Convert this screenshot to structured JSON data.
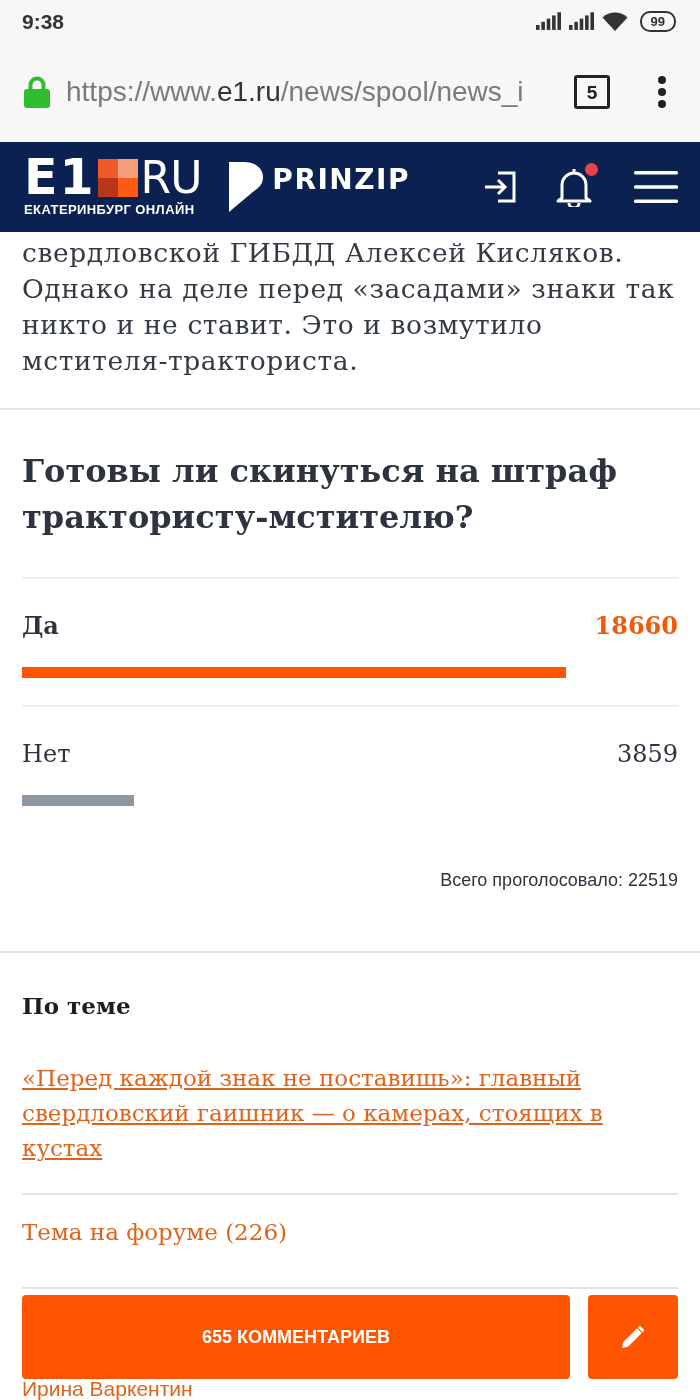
{
  "status_bar": {
    "time": "9:38",
    "battery": "99"
  },
  "browser": {
    "url": {
      "scheme": "https://www.",
      "host": "e1.ru",
      "path": "/news/spool/news_i"
    },
    "tab_count": "5"
  },
  "header": {
    "logo": "E1",
    "logo_suffix": "RU",
    "tagline": "ЕКАТЕРИНБУРГ ОНЛАЙН",
    "partner": "PRINZIP",
    "has_unread": true
  },
  "article": {
    "paragraph": "свердловской ГИБДД Алексей Кисляков. Однако на деле перед «засадами» знаки так никто и не ставит. Это и возмутило мстителя-тракториста."
  },
  "poll": {
    "question": "Готовы ли скинуться на штраф трактористу-мстителю?",
    "options": [
      {
        "label": "Да",
        "count": "18660",
        "level": 0.829,
        "leading": true
      },
      {
        "label": "Нет",
        "count": "3859",
        "level": 0.171,
        "leading": false
      }
    ],
    "total": "Всего проголосовало: 22519"
  },
  "related": {
    "heading": "По теме",
    "links": [
      {
        "kind": "article",
        "text": "«Перед каждой знак не поставишь»: главный свердловский гаишник — о камерах, стоящих в кустах"
      },
      {
        "kind": "forum",
        "text": "Тема на форуме (226)"
      }
    ]
  },
  "comments_bar": {
    "button": "655 КОММЕНТАРИЕВ"
  },
  "comment_author": "Ирина Варкентин"
}
